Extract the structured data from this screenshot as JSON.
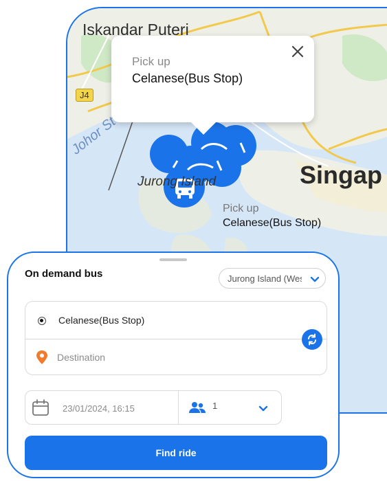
{
  "map": {
    "labels": {
      "iskandar": "Iskandar Puteri",
      "road_badge": "J4",
      "johor": "Johor St",
      "jurong": "Jurong Island",
      "singapore": "Singap"
    },
    "popup": {
      "title": "Pick up",
      "stop": "Celanese(Bus Stop)"
    },
    "marker_label": {
      "title": "Pick up",
      "stop": "Celanese(Bus Stop)"
    },
    "colors": {
      "water": "#d5e6f7",
      "land": "#eef0e8",
      "park": "#cfe8c6",
      "road": "#f2c94c",
      "marker": "#1a73e8"
    }
  },
  "sheet": {
    "title": "On demand bus",
    "zone_selected": "Jurong Island (West)",
    "origin": "Celanese(Bus Stop)",
    "destination_value": "",
    "destination_placeholder": "Destination",
    "datetime": "23/01/2024, 16:15",
    "passengers": "1",
    "find_ride_label": "Find ride",
    "colors": {
      "accent": "#1a73e8",
      "pin": "#f07b2c"
    }
  }
}
